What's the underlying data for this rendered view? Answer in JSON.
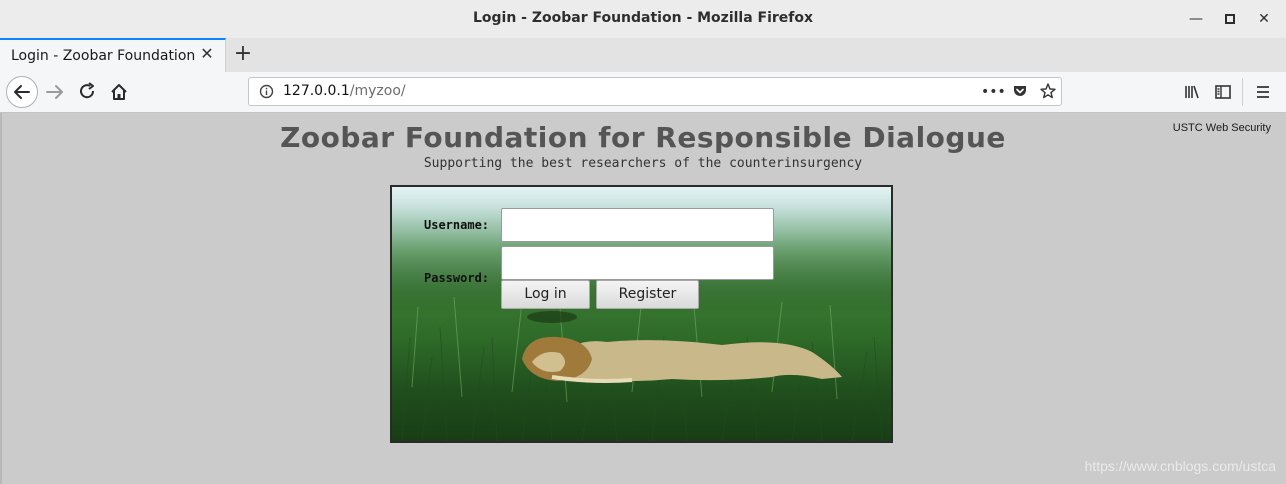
{
  "window": {
    "title": "Login - Zoobar Foundation - Mozilla Firefox"
  },
  "tabs": [
    {
      "label": "Login - Zoobar Foundation"
    }
  ],
  "navbar": {
    "url_host": "127.0.0.1",
    "url_path": "/myzoo/"
  },
  "page": {
    "corner_link": "USTC Web Security",
    "heading": "Zoobar Foundation for Responsible Dialogue",
    "subheading": "Supporting the best researchers of the counterinsurgency",
    "login": {
      "username_label": "Username:",
      "password_label": "Password:",
      "username_value": "",
      "password_value": "",
      "login_button": "Log in",
      "register_button": "Register"
    }
  },
  "watermark": "https://www.cnblogs.com/ustca",
  "icons": {
    "back": "back-arrow-icon",
    "forward": "forward-arrow-icon",
    "reload": "reload-icon",
    "home": "home-icon",
    "info": "info-icon",
    "page_actions": "more-dots-icon",
    "pocket": "pocket-icon",
    "bookmark": "star-icon",
    "library": "library-icon",
    "sidebar": "sidebar-icon",
    "menu": "hamburger-menu-icon"
  }
}
